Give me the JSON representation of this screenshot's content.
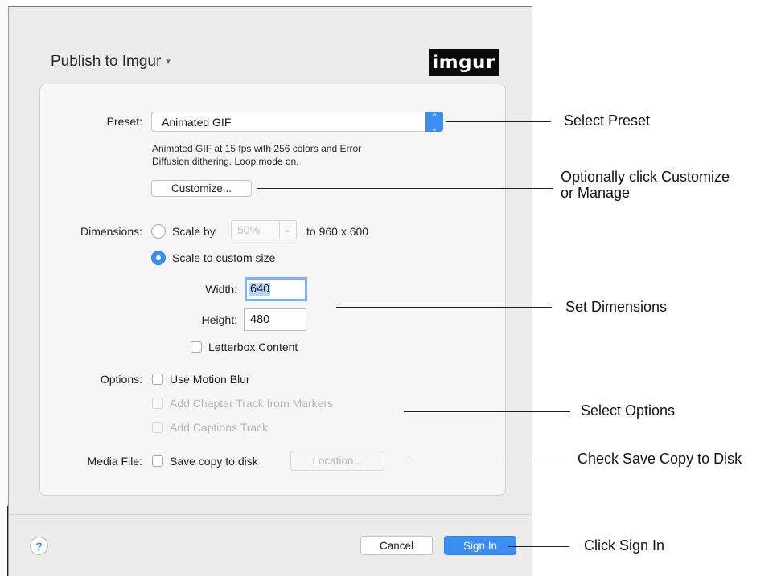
{
  "dialog": {
    "title": "Publish to Imgur",
    "title_caret": "▾",
    "logo_text": "imgur"
  },
  "preset": {
    "label": "Preset:",
    "value": "Animated GIF",
    "description_line1": "Animated GIF at 15 fps with 256 colors and Error",
    "description_line2": "Diffusion dithering.  Loop mode on.",
    "customize_label": "Customize..."
  },
  "dimensions": {
    "label": "Dimensions:",
    "scale_by_label": "Scale by",
    "scale_by_value": "50%",
    "scale_by_result": "to 960 x 600",
    "scale_custom_label": "Scale to custom size",
    "width_label": "Width:",
    "width_value": "640",
    "height_label": "Height:",
    "height_value": "480",
    "letterbox_label": "Letterbox Content"
  },
  "options": {
    "label": "Options:",
    "motion_blur_label": "Use Motion Blur",
    "chapter_track_label": "Add Chapter Track from Markers",
    "captions_track_label": "Add Captions Track"
  },
  "media_file": {
    "label": "Media File:",
    "save_copy_label": "Save copy to disk",
    "location_label": "Location..."
  },
  "footer": {
    "help_label": "?",
    "cancel_label": "Cancel",
    "signin_label": "Sign In"
  },
  "callouts": {
    "select_preset": "Select Preset",
    "customize_line1": "Optionally click Customize",
    "customize_line2": "or Manage",
    "set_dimensions": "Set Dimensions",
    "select_options": "Select Options",
    "save_copy": "Check Save Copy to Disk",
    "sign_in": "Click Sign In"
  },
  "colors": {
    "accent": "#3b8ef2",
    "dialog_bg": "#ececec",
    "panel_bg": "#f6f6f6"
  }
}
